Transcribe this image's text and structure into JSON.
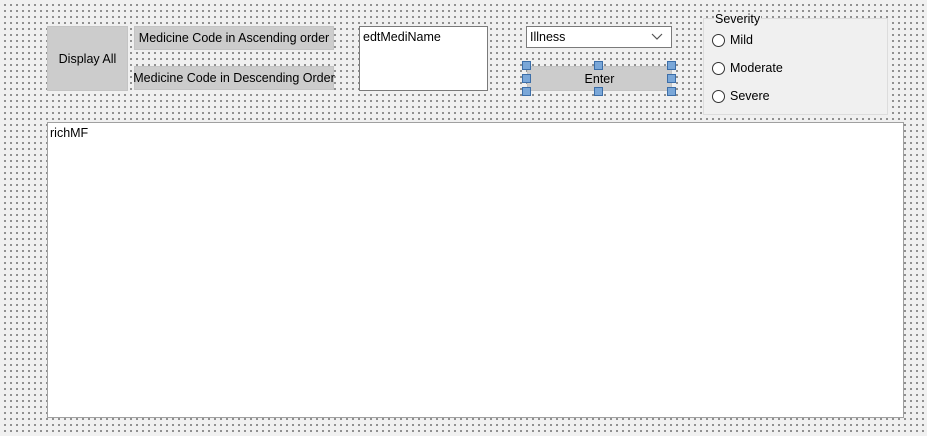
{
  "buttons": {
    "display_all": "Display All",
    "asc": "Medicine Code in Ascending order",
    "desc": "Medicine Code in Descending Order",
    "enter": "Enter"
  },
  "edit_medi_name": {
    "value": "edtMediName"
  },
  "illness_combo": {
    "selected": "Illness",
    "icon": "chevron-down-icon"
  },
  "severity": {
    "title": "Severity",
    "options": [
      "Mild",
      "Moderate",
      "Severe"
    ]
  },
  "memo": {
    "value": "richMF"
  },
  "colors": {
    "button_face": "#cccccc",
    "form_background": "#f0f0f0",
    "selection_handle": "#7aa7d8"
  }
}
